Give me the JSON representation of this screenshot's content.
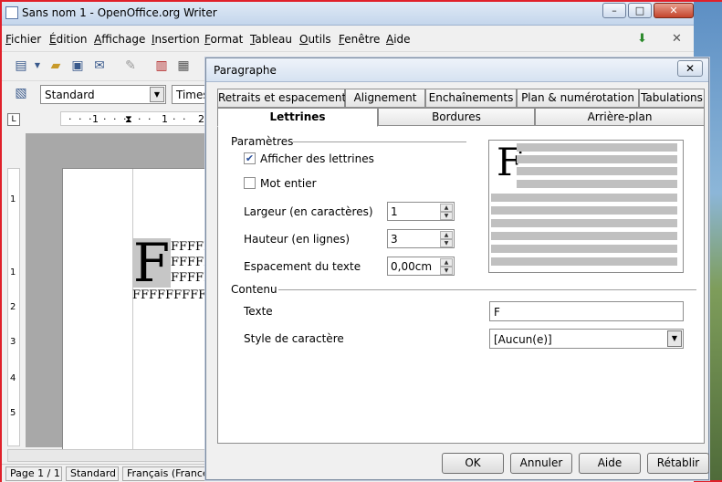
{
  "writer": {
    "title": "Sans nom 1 - OpenOffice.org Writer",
    "window_buttons": {
      "minimize": "–",
      "maximize": "□",
      "close": "✕"
    },
    "menu": [
      "Fichier",
      "Édition",
      "Affichage",
      "Insertion",
      "Format",
      "Tableau",
      "Outils",
      "Fenêtre",
      "Aide"
    ],
    "paragraph_style": "Standard",
    "font_name": "Times",
    "ruler_marks": [
      "1",
      "1",
      "2"
    ],
    "vertical_ruler_marks": [
      "1",
      "1",
      "2",
      "3",
      "4",
      "5"
    ],
    "document": {
      "dropcap": "F",
      "lines": [
        "FFFFFFF",
        "FFFFFFF",
        "FFFFFFF",
        "FFFFFFFFFFFFF"
      ]
    },
    "status": {
      "page": "Page 1 / 1",
      "style": "Standard",
      "language": "Français (France)"
    }
  },
  "dialog": {
    "title": "Paragraphe",
    "close_label": "✕",
    "tabs_row1": [
      "Retraits et espacement",
      "Alignement",
      "Enchaînements",
      "Plan & numérotation",
      "Tabulations"
    ],
    "tabs_row2": [
      "Lettrines",
      "Bordures",
      "Arrière-plan"
    ],
    "active_tab": "Lettrines",
    "parametres": {
      "title": "Paramètres",
      "afficher_label": "Afficher des lettrines",
      "afficher_checked": true,
      "mot_entier_label": "Mot entier",
      "mot_entier_checked": false,
      "largeur_label": "Largeur (en caractères)",
      "largeur_value": "1",
      "hauteur_label": "Hauteur (en lignes)",
      "hauteur_value": "3",
      "espacement_label": "Espacement du texte",
      "espacement_value": "0,00cm"
    },
    "preview": {
      "letter": "F"
    },
    "contenu": {
      "title": "Contenu",
      "texte_label": "Texte",
      "texte_value": "F",
      "style_label": "Style de caractère",
      "style_value": "[Aucun(e)]"
    },
    "buttons": {
      "ok": "OK",
      "cancel": "Annuler",
      "help": "Aide",
      "reset": "Rétablir"
    }
  }
}
